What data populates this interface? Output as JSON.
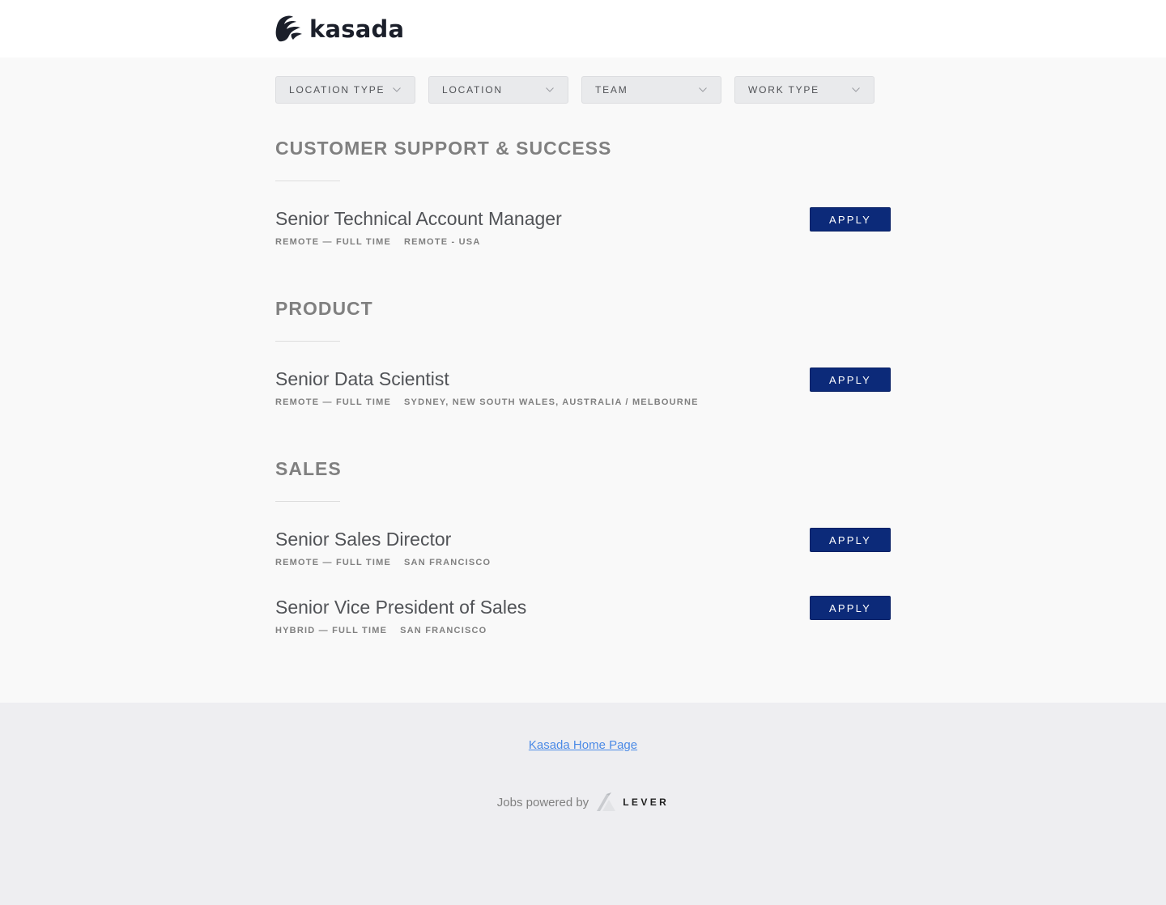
{
  "brand": {
    "name": "kasada",
    "logo_icon": "kasada-logo-icon"
  },
  "filters": [
    {
      "label": "LOCATION TYPE",
      "icon": "chevron-down-icon"
    },
    {
      "label": "LOCATION",
      "icon": "chevron-down-icon"
    },
    {
      "label": "TEAM",
      "icon": "chevron-down-icon"
    },
    {
      "label": "WORK TYPE",
      "icon": "chevron-down-icon"
    }
  ],
  "groups": [
    {
      "title": "CUSTOMER SUPPORT & SUCCESS",
      "postings": [
        {
          "title": "Senior Technical Account Manager",
          "commitment": "REMOTE — FULL TIME",
          "location": "REMOTE - USA",
          "apply_label": "APPLY"
        }
      ]
    },
    {
      "title": "PRODUCT",
      "postings": [
        {
          "title": "Senior Data Scientist",
          "commitment": "REMOTE — FULL TIME",
          "location": "SYDNEY, NEW SOUTH WALES, AUSTRALIA / MELBOURNE",
          "apply_label": "APPLY"
        }
      ]
    },
    {
      "title": "SALES",
      "postings": [
        {
          "title": "Senior Sales Director",
          "commitment": "REMOTE — FULL TIME",
          "location": "SAN FRANCISCO",
          "apply_label": "APPLY"
        },
        {
          "title": "Senior Vice President of Sales",
          "commitment": "HYBRID — FULL TIME",
          "location": "SAN FRANCISCO",
          "apply_label": "APPLY"
        }
      ]
    }
  ],
  "footer": {
    "home_link": "Kasada Home Page",
    "powered_by": "Jobs powered by",
    "lever_wordmark": "LEVER",
    "lever_icon": "lever-logo-icon"
  },
  "colors": {
    "apply_button": "#0c2a79",
    "link": "#4b8ae6",
    "page_bg": "#f9f9f9",
    "footer_bg": "#eeeef1"
  }
}
